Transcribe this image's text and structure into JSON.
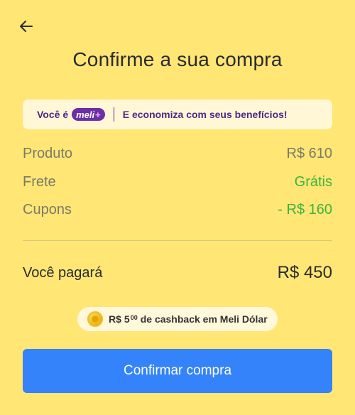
{
  "header": {
    "back_icon": "arrow-left-icon",
    "title": "Confirme a sua compra"
  },
  "banner": {
    "prefix": "Você é",
    "badge_text": "meli",
    "badge_plus": "+",
    "message": "E economiza com seus benefícios!",
    "colors": {
      "text": "#4A2B86",
      "badge_bg": "#6C2FA5",
      "bg": "#FFF7D6"
    }
  },
  "summary": {
    "rows": [
      {
        "label": "Produto",
        "value": "R$ 610"
      },
      {
        "label": "Frete",
        "value": "Grátis"
      },
      {
        "label": "Cupons",
        "value": "- R$ 160"
      }
    ]
  },
  "total": {
    "label": "Você pagará",
    "amount": "R$ 450"
  },
  "cashback": {
    "icon": "coin-icon",
    "currency": "R$",
    "integer": "5",
    "cents": "00",
    "text": "de cashback em Meli Dólar"
  },
  "actions": {
    "confirm_label": "Confirmar compra"
  },
  "colors": {
    "background": "#FFE675",
    "primary": "#3483FA",
    "success": "#3FB33F"
  }
}
